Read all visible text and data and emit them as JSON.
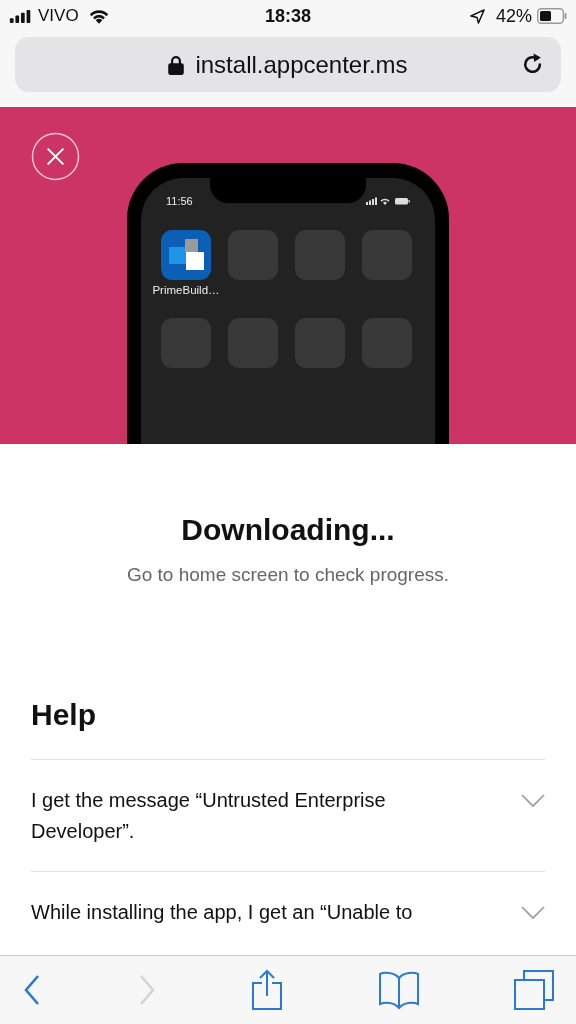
{
  "status_bar": {
    "carrier": "VIVO",
    "time": "18:38",
    "battery": "42%"
  },
  "address_bar": {
    "url": "install.appcenter.ms",
    "secure": true
  },
  "hero": {
    "phone": {
      "time": "11:56",
      "apps": [
        {
          "kind": "app",
          "label": "PrimeBuild…"
        },
        {
          "kind": "placeholder"
        },
        {
          "kind": "placeholder"
        },
        {
          "kind": "placeholder"
        },
        {
          "kind": "placeholder"
        },
        {
          "kind": "placeholder"
        },
        {
          "kind": "placeholder"
        },
        {
          "kind": "placeholder"
        }
      ]
    }
  },
  "title": "Downloading...",
  "subtitle": "Go to home screen to check progress.",
  "help": {
    "heading": "Help",
    "items": [
      {
        "question": "I get the message “Untrusted Enterprise Developer”.",
        "expanded": false
      },
      {
        "question": "While installing the app, I get an “Unable to",
        "expanded": false
      }
    ]
  },
  "toolbar": [
    {
      "kind": "back",
      "disabled": false
    },
    {
      "kind": "forward",
      "disabled": true
    },
    {
      "kind": "share",
      "disabled": false
    },
    {
      "kind": "bookmarks",
      "disabled": false
    },
    {
      "kind": "tabs",
      "disabled": false
    }
  ]
}
